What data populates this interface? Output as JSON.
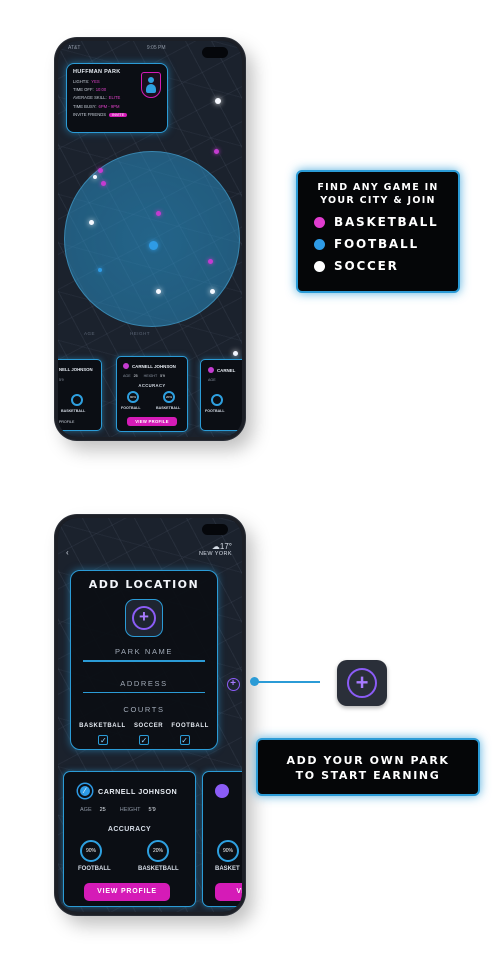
{
  "phone1": {
    "status_left": "AT&T",
    "status_center": "9:05 PM",
    "park_card": {
      "title": "HUFFMAN PARK",
      "rows": [
        {
          "label": "LIGHTS:",
          "value": "YES"
        },
        {
          "label": "TIME OFF:",
          "value": "10:00"
        },
        {
          "label": "AVERAGE SKILL:",
          "value": "ELITE"
        },
        {
          "label": "TIME BUSY:",
          "value": "6PM - 9PM"
        },
        {
          "label": "INVITE FRIENDS",
          "value": "INVITE"
        }
      ]
    },
    "map_labels": {
      "age": "AGE",
      "height": "HEIGHT"
    },
    "cards": {
      "left": {
        "name": "NELL JOHNSON",
        "stat_label": "HEIGHT",
        "stat_value": "5'9",
        "sport": "BASKETBALL",
        "profile": "PROFILE"
      },
      "center": {
        "name": "CARNELL JOHNSON",
        "age_label": "AGE",
        "age": "25",
        "height_label": "HEIGHT",
        "height": "5'9",
        "accuracy": "ACCURACY",
        "stats": [
          {
            "pct": "90%",
            "sport": "FOOTBALL"
          },
          {
            "pct": "20%",
            "sport": "BASKETBALL"
          }
        ],
        "button": "VIEW PROFILE"
      },
      "right": {
        "name": "CARNEL",
        "age_label": "AGE",
        "sport": "FOOTBALL"
      }
    }
  },
  "legend": {
    "title_line1": "FIND ANY GAME IN",
    "title_line2": "YOUR CITY & JOIN",
    "items": [
      {
        "label": "BASKETBALL",
        "color": "#e03ccf"
      },
      {
        "label": "FOOTBALL",
        "color": "#2e9be6"
      },
      {
        "label": "SOCCER",
        "color": "#ffffff"
      }
    ]
  },
  "phone2": {
    "weather": {
      "temp": "17°",
      "city": "NEW YORK"
    },
    "add_location": {
      "title": "ADD LOCATION",
      "park_name_label": "PARK NAME",
      "address_label": "ADDRESS",
      "courts_label": "COURTS",
      "courts": [
        "BASKETBALL",
        "SOCCER",
        "FOOTBALL"
      ],
      "check_glyph": "✓"
    },
    "card": {
      "name": "CARNELL JOHNSON",
      "age_label": "AGE",
      "age": "25",
      "height_label": "HEIGHT",
      "height": "5'9",
      "accuracy": "ACCURACY",
      "stats": [
        {
          "pct": "90%",
          "sport": "FOOTBALL"
        },
        {
          "pct": "20%",
          "sport": "BASKETBALL"
        }
      ],
      "button": "VIEW PROFILE"
    },
    "right_card": {
      "pct": "90%",
      "sport": "BASKET",
      "button": "VI"
    }
  },
  "callout": {
    "line1": "ADD YOUR OWN PARK",
    "line2": "TO START EARNING"
  },
  "colors": {
    "accent": "#2b9bd6",
    "magenta": "#d51bb7",
    "purple": "#8b5cf6"
  }
}
